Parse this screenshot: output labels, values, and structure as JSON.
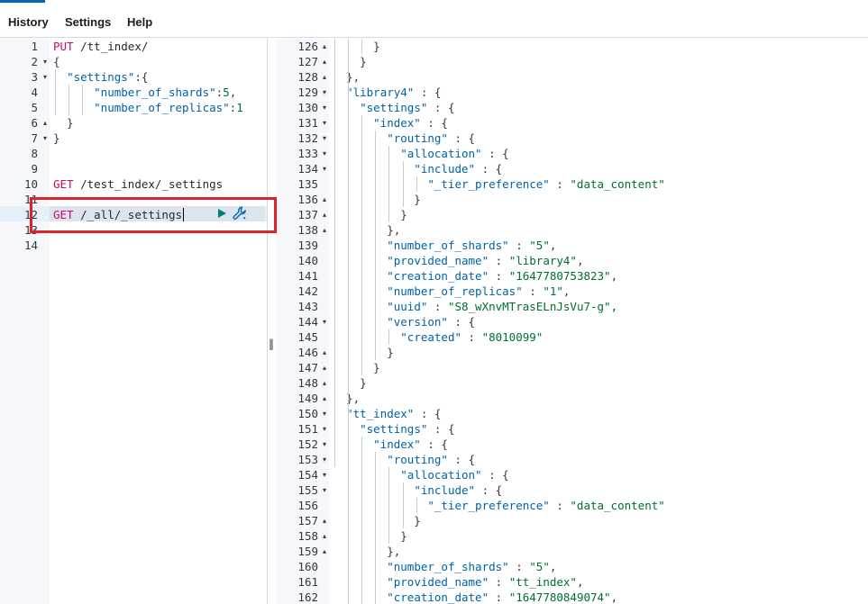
{
  "menu": {
    "history": "History",
    "settings": "Settings",
    "help": "Help"
  },
  "request_editor": {
    "lines": [
      {
        "n": "1",
        "fold": "",
        "tokens": [
          {
            "t": "PUT ",
            "c": "method"
          },
          {
            "t": "/tt_index/",
            "c": "url"
          }
        ]
      },
      {
        "n": "2",
        "fold": "▾",
        "tokens": [
          {
            "t": "{",
            "c": "punc"
          }
        ]
      },
      {
        "n": "3",
        "fold": "▾",
        "tokens": [
          {
            "t": "  ",
            "c": "punc"
          },
          {
            "t": "\"settings\"",
            "c": "key"
          },
          {
            "t": ":{",
            "c": "punc"
          }
        ]
      },
      {
        "n": "4",
        "fold": "",
        "tokens": [
          {
            "t": "      ",
            "c": "punc"
          },
          {
            "t": "\"number_of_shards\"",
            "c": "key"
          },
          {
            "t": ":",
            "c": "punc"
          },
          {
            "t": "5",
            "c": "num"
          },
          {
            "t": ",",
            "c": "punc"
          }
        ]
      },
      {
        "n": "5",
        "fold": "",
        "tokens": [
          {
            "t": "      ",
            "c": "punc"
          },
          {
            "t": "\"number_of_replicas\"",
            "c": "key"
          },
          {
            "t": ":",
            "c": "punc"
          },
          {
            "t": "1",
            "c": "num"
          }
        ]
      },
      {
        "n": "6",
        "fold": "▴",
        "tokens": [
          {
            "t": "  }",
            "c": "punc"
          }
        ]
      },
      {
        "n": "7",
        "fold": "▾",
        "tokens": [
          {
            "t": "}",
            "c": "punc"
          }
        ]
      },
      {
        "n": "8",
        "fold": "",
        "tokens": []
      },
      {
        "n": "9",
        "fold": "",
        "tokens": []
      },
      {
        "n": "10",
        "fold": "",
        "tokens": [
          {
            "t": "GET ",
            "c": "method"
          },
          {
            "t": "/test_index/_settings",
            "c": "url"
          }
        ]
      },
      {
        "n": "11",
        "fold": "",
        "tokens": []
      },
      {
        "n": "12",
        "fold": "",
        "tokens": [
          {
            "t": "GET ",
            "c": "method"
          },
          {
            "t": "/_all/_settings",
            "c": "url"
          }
        ]
      },
      {
        "n": "13",
        "fold": "",
        "tokens": []
      },
      {
        "n": "14",
        "fold": "",
        "tokens": []
      }
    ],
    "active_line": "12"
  },
  "response_viewer": {
    "lines": [
      {
        "n": "126",
        "fold": "▴",
        "tokens": [
          {
            "t": "      }",
            "c": "punc"
          }
        ]
      },
      {
        "n": "127",
        "fold": "▴",
        "tokens": [
          {
            "t": "    }",
            "c": "punc"
          }
        ]
      },
      {
        "n": "128",
        "fold": "▴",
        "tokens": [
          {
            "t": "  },",
            "c": "punc"
          }
        ]
      },
      {
        "n": "129",
        "fold": "▾",
        "tokens": [
          {
            "t": "  ",
            "c": "punc"
          },
          {
            "t": "\"library4\"",
            "c": "key"
          },
          {
            "t": " : {",
            "c": "punc"
          }
        ]
      },
      {
        "n": "130",
        "fold": "▾",
        "tokens": [
          {
            "t": "    ",
            "c": "punc"
          },
          {
            "t": "\"settings\"",
            "c": "key"
          },
          {
            "t": " : {",
            "c": "punc"
          }
        ]
      },
      {
        "n": "131",
        "fold": "▾",
        "tokens": [
          {
            "t": "      ",
            "c": "punc"
          },
          {
            "t": "\"index\"",
            "c": "key"
          },
          {
            "t": " : {",
            "c": "punc"
          }
        ]
      },
      {
        "n": "132",
        "fold": "▾",
        "tokens": [
          {
            "t": "        ",
            "c": "punc"
          },
          {
            "t": "\"routing\"",
            "c": "key"
          },
          {
            "t": " : {",
            "c": "punc"
          }
        ]
      },
      {
        "n": "133",
        "fold": "▾",
        "tokens": [
          {
            "t": "          ",
            "c": "punc"
          },
          {
            "t": "\"allocation\"",
            "c": "key"
          },
          {
            "t": " : {",
            "c": "punc"
          }
        ]
      },
      {
        "n": "134",
        "fold": "▾",
        "tokens": [
          {
            "t": "            ",
            "c": "punc"
          },
          {
            "t": "\"include\"",
            "c": "key"
          },
          {
            "t": " : {",
            "c": "punc"
          }
        ]
      },
      {
        "n": "135",
        "fold": "",
        "tokens": [
          {
            "t": "              ",
            "c": "punc"
          },
          {
            "t": "\"_tier_preference\"",
            "c": "key"
          },
          {
            "t": " : ",
            "c": "punc"
          },
          {
            "t": "\"data_content\"",
            "c": "str"
          }
        ]
      },
      {
        "n": "136",
        "fold": "▴",
        "tokens": [
          {
            "t": "            }",
            "c": "punc"
          }
        ]
      },
      {
        "n": "137",
        "fold": "▴",
        "tokens": [
          {
            "t": "          }",
            "c": "punc"
          }
        ]
      },
      {
        "n": "138",
        "fold": "▴",
        "tokens": [
          {
            "t": "        },",
            "c": "punc"
          }
        ]
      },
      {
        "n": "139",
        "fold": "",
        "tokens": [
          {
            "t": "        ",
            "c": "punc"
          },
          {
            "t": "\"number_of_shards\"",
            "c": "key"
          },
          {
            "t": " : ",
            "c": "punc"
          },
          {
            "t": "\"5\"",
            "c": "str"
          },
          {
            "t": ",",
            "c": "punc"
          }
        ]
      },
      {
        "n": "140",
        "fold": "",
        "tokens": [
          {
            "t": "        ",
            "c": "punc"
          },
          {
            "t": "\"provided_name\"",
            "c": "key"
          },
          {
            "t": " : ",
            "c": "punc"
          },
          {
            "t": "\"library4\"",
            "c": "str"
          },
          {
            "t": ",",
            "c": "punc"
          }
        ]
      },
      {
        "n": "141",
        "fold": "",
        "tokens": [
          {
            "t": "        ",
            "c": "punc"
          },
          {
            "t": "\"creation_date\"",
            "c": "key"
          },
          {
            "t": " : ",
            "c": "punc"
          },
          {
            "t": "\"1647780753823\"",
            "c": "str"
          },
          {
            "t": ",",
            "c": "punc"
          }
        ]
      },
      {
        "n": "142",
        "fold": "",
        "tokens": [
          {
            "t": "        ",
            "c": "punc"
          },
          {
            "t": "\"number_of_replicas\"",
            "c": "key"
          },
          {
            "t": " : ",
            "c": "punc"
          },
          {
            "t": "\"1\"",
            "c": "str"
          },
          {
            "t": ",",
            "c": "punc"
          }
        ]
      },
      {
        "n": "143",
        "fold": "",
        "tokens": [
          {
            "t": "        ",
            "c": "punc"
          },
          {
            "t": "\"uuid\"",
            "c": "key"
          },
          {
            "t": " : ",
            "c": "punc"
          },
          {
            "t": "\"S8_wXnvMTrasELnJsVu7-g\"",
            "c": "str"
          },
          {
            "t": ",",
            "c": "punc"
          }
        ]
      },
      {
        "n": "144",
        "fold": "▾",
        "tokens": [
          {
            "t": "        ",
            "c": "punc"
          },
          {
            "t": "\"version\"",
            "c": "key"
          },
          {
            "t": " : {",
            "c": "punc"
          }
        ]
      },
      {
        "n": "145",
        "fold": "",
        "tokens": [
          {
            "t": "          ",
            "c": "punc"
          },
          {
            "t": "\"created\"",
            "c": "key"
          },
          {
            "t": " : ",
            "c": "punc"
          },
          {
            "t": "\"8010099\"",
            "c": "str"
          }
        ]
      },
      {
        "n": "146",
        "fold": "▴",
        "tokens": [
          {
            "t": "        }",
            "c": "punc"
          }
        ]
      },
      {
        "n": "147",
        "fold": "▴",
        "tokens": [
          {
            "t": "      }",
            "c": "punc"
          }
        ]
      },
      {
        "n": "148",
        "fold": "▴",
        "tokens": [
          {
            "t": "    }",
            "c": "punc"
          }
        ]
      },
      {
        "n": "149",
        "fold": "▴",
        "tokens": [
          {
            "t": "  },",
            "c": "punc"
          }
        ]
      },
      {
        "n": "150",
        "fold": "▾",
        "tokens": [
          {
            "t": "  ",
            "c": "punc"
          },
          {
            "t": "\"tt_index\"",
            "c": "key"
          },
          {
            "t": " : {",
            "c": "punc"
          }
        ]
      },
      {
        "n": "151",
        "fold": "▾",
        "tokens": [
          {
            "t": "    ",
            "c": "punc"
          },
          {
            "t": "\"settings\"",
            "c": "key"
          },
          {
            "t": " : {",
            "c": "punc"
          }
        ]
      },
      {
        "n": "152",
        "fold": "▾",
        "tokens": [
          {
            "t": "      ",
            "c": "punc"
          },
          {
            "t": "\"index\"",
            "c": "key"
          },
          {
            "t": " : {",
            "c": "punc"
          }
        ]
      },
      {
        "n": "153",
        "fold": "▾",
        "tokens": [
          {
            "t": "        ",
            "c": "punc"
          },
          {
            "t": "\"routing\"",
            "c": "key"
          },
          {
            "t": " : {",
            "c": "punc"
          }
        ]
      },
      {
        "n": "154",
        "fold": "▾",
        "tokens": [
          {
            "t": "          ",
            "c": "punc"
          },
          {
            "t": "\"allocation\"",
            "c": "key"
          },
          {
            "t": " : {",
            "c": "punc"
          }
        ]
      },
      {
        "n": "155",
        "fold": "▾",
        "tokens": [
          {
            "t": "            ",
            "c": "punc"
          },
          {
            "t": "\"include\"",
            "c": "key"
          },
          {
            "t": " : {",
            "c": "punc"
          }
        ]
      },
      {
        "n": "156",
        "fold": "",
        "tokens": [
          {
            "t": "              ",
            "c": "punc"
          },
          {
            "t": "\"_tier_preference\"",
            "c": "key"
          },
          {
            "t": " : ",
            "c": "punc"
          },
          {
            "t": "\"data_content\"",
            "c": "str"
          }
        ]
      },
      {
        "n": "157",
        "fold": "▴",
        "tokens": [
          {
            "t": "            }",
            "c": "punc"
          }
        ]
      },
      {
        "n": "158",
        "fold": "▴",
        "tokens": [
          {
            "t": "          }",
            "c": "punc"
          }
        ]
      },
      {
        "n": "159",
        "fold": "▴",
        "tokens": [
          {
            "t": "        },",
            "c": "punc"
          }
        ]
      },
      {
        "n": "160",
        "fold": "",
        "tokens": [
          {
            "t": "        ",
            "c": "punc"
          },
          {
            "t": "\"number_of_shards\"",
            "c": "key"
          },
          {
            "t": " : ",
            "c": "punc"
          },
          {
            "t": "\"5\"",
            "c": "str"
          },
          {
            "t": ",",
            "c": "punc"
          }
        ]
      },
      {
        "n": "161",
        "fold": "",
        "tokens": [
          {
            "t": "        ",
            "c": "punc"
          },
          {
            "t": "\"provided_name\"",
            "c": "key"
          },
          {
            "t": " : ",
            "c": "punc"
          },
          {
            "t": "\"tt_index\"",
            "c": "str"
          },
          {
            "t": ",",
            "c": "punc"
          }
        ]
      },
      {
        "n": "162",
        "fold": "",
        "tokens": [
          {
            "t": "        ",
            "c": "punc"
          },
          {
            "t": "\"creation_date\"",
            "c": "key"
          },
          {
            "t": " : ",
            "c": "punc"
          },
          {
            "t": "\"1647780849074\"",
            "c": "str"
          },
          {
            "t": ",",
            "c": "punc"
          }
        ]
      }
    ]
  },
  "icons": {
    "play": "play-icon",
    "wrench": "wrench-icon",
    "resize": "resize-handle-icon"
  },
  "colors": {
    "accent": "#006bb4",
    "method": "#c80a68",
    "key": "#0061a6",
    "string": "#006e2f",
    "play": "#017d73",
    "wrench": "#006bb4",
    "highlight": "#e0202a"
  }
}
